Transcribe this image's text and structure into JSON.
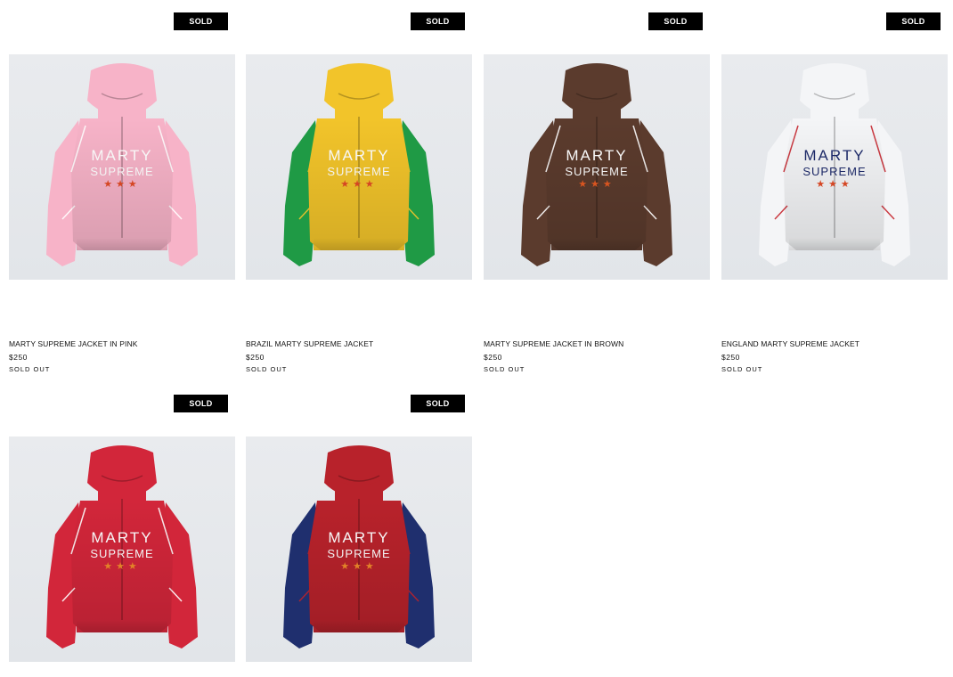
{
  "products": [
    {
      "title": "MARTY SUPREME JACKET IN PINK",
      "price": "$250",
      "status": "SOLD OUT",
      "badge": "SOLD OUT",
      "jacket": {
        "body": "#f7b3c8",
        "sleeve": "#f7b3c8",
        "hood": "#f7b3c8",
        "text": "#ffffff",
        "star": "#e24a25",
        "trim": "#ffffff",
        "label_top": "MARTY",
        "label_bottom": "SUPREME"
      }
    },
    {
      "title": "BRAZIL MARTY SUPREME JACKET",
      "price": "$250",
      "status": "SOLD OUT",
      "badge": "SOLD OUT",
      "jacket": {
        "body": "#f2c42a",
        "sleeve": "#1f9a45",
        "hood": "#f2c42a",
        "text": "#ffffff",
        "star": "#e24a25",
        "trim": "#f2c42a",
        "label_top": "MARTY",
        "label_bottom": "SUPREME"
      }
    },
    {
      "title": "MARTY SUPREME JACKET IN BROWN",
      "price": "$250",
      "status": "SOLD OUT",
      "badge": "SOLD OUT",
      "jacket": {
        "body": "#5b3b2d",
        "sleeve": "#5b3b2d",
        "hood": "#5b3b2d",
        "text": "#ffffff",
        "star": "#e65a22",
        "trim": "#ffffff",
        "label_top": "MARTY",
        "label_bottom": "SUPREME"
      }
    },
    {
      "title": "ENGLAND MARTY SUPREME JACKET",
      "price": "$250",
      "status": "SOLD OUT",
      "badge": "SOLD OUT",
      "jacket": {
        "body": "#f4f5f7",
        "sleeve": "#f4f5f7",
        "hood": "#f4f5f7",
        "text": "#1e2b6b",
        "star": "#e24a25",
        "trim": "#c6262e",
        "label_top": "MARTY",
        "label_bottom": "SUPREME"
      }
    },
    {
      "badge": "SOLD OUT",
      "jacket": {
        "body": "#d2263a",
        "sleeve": "#d2263a",
        "hood": "#d2263a",
        "text": "#ffffff",
        "star": "#f08a2a",
        "trim": "#ffffff",
        "label_top": "MARTY",
        "label_bottom": "SUPREME"
      }
    },
    {
      "badge": "SOLD OUT",
      "jacket": {
        "body": "#b8222b",
        "sleeve": "#1f2f6e",
        "hood": "#b8222b",
        "text": "#ffffff",
        "star": "#f08a2a",
        "trim": "#b8222b",
        "label_top": "MARTY",
        "label_bottom": "SUPREME"
      }
    }
  ]
}
